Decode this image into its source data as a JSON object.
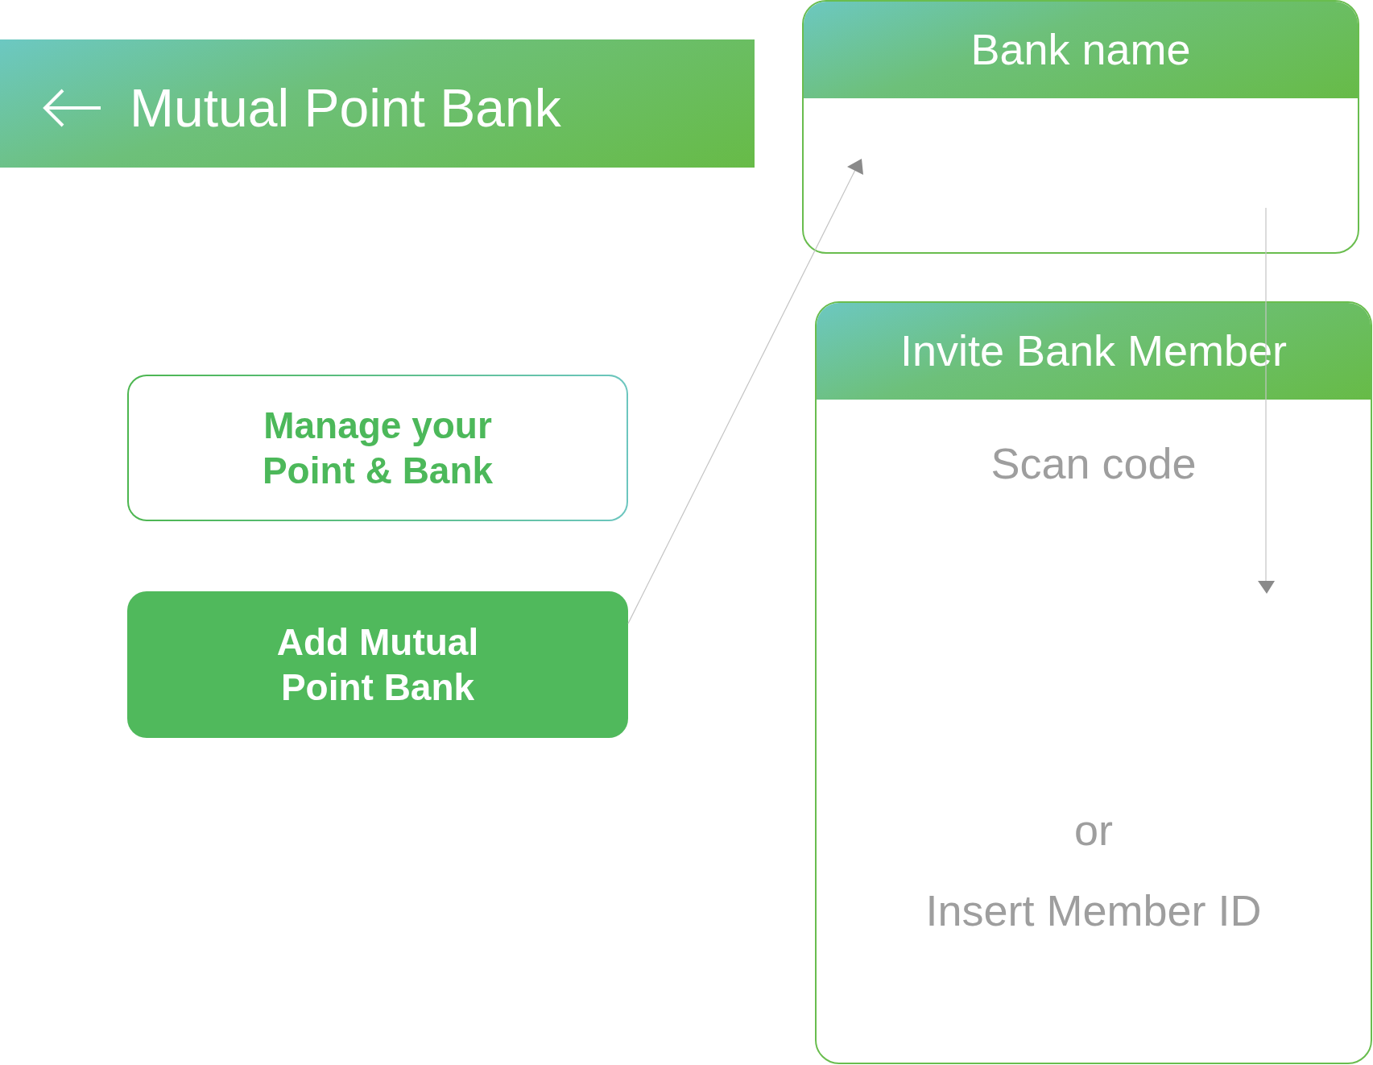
{
  "app_bar": {
    "title": "Mutual Point Bank"
  },
  "buttons": [
    {
      "label": "Manage your Point & Bank",
      "kind": "outline"
    },
    {
      "label": "Add Mutual Point Bank",
      "kind": "filled"
    }
  ],
  "bank_name_card": {
    "title": "Bank name"
  },
  "invite_card": {
    "title": "Invite Bank Member",
    "items": [
      {
        "text": "Scan code",
        "kind": "option"
      },
      {
        "text": "or",
        "kind": "separator"
      },
      {
        "text": "Insert Member ID",
        "kind": "option"
      }
    ]
  }
}
